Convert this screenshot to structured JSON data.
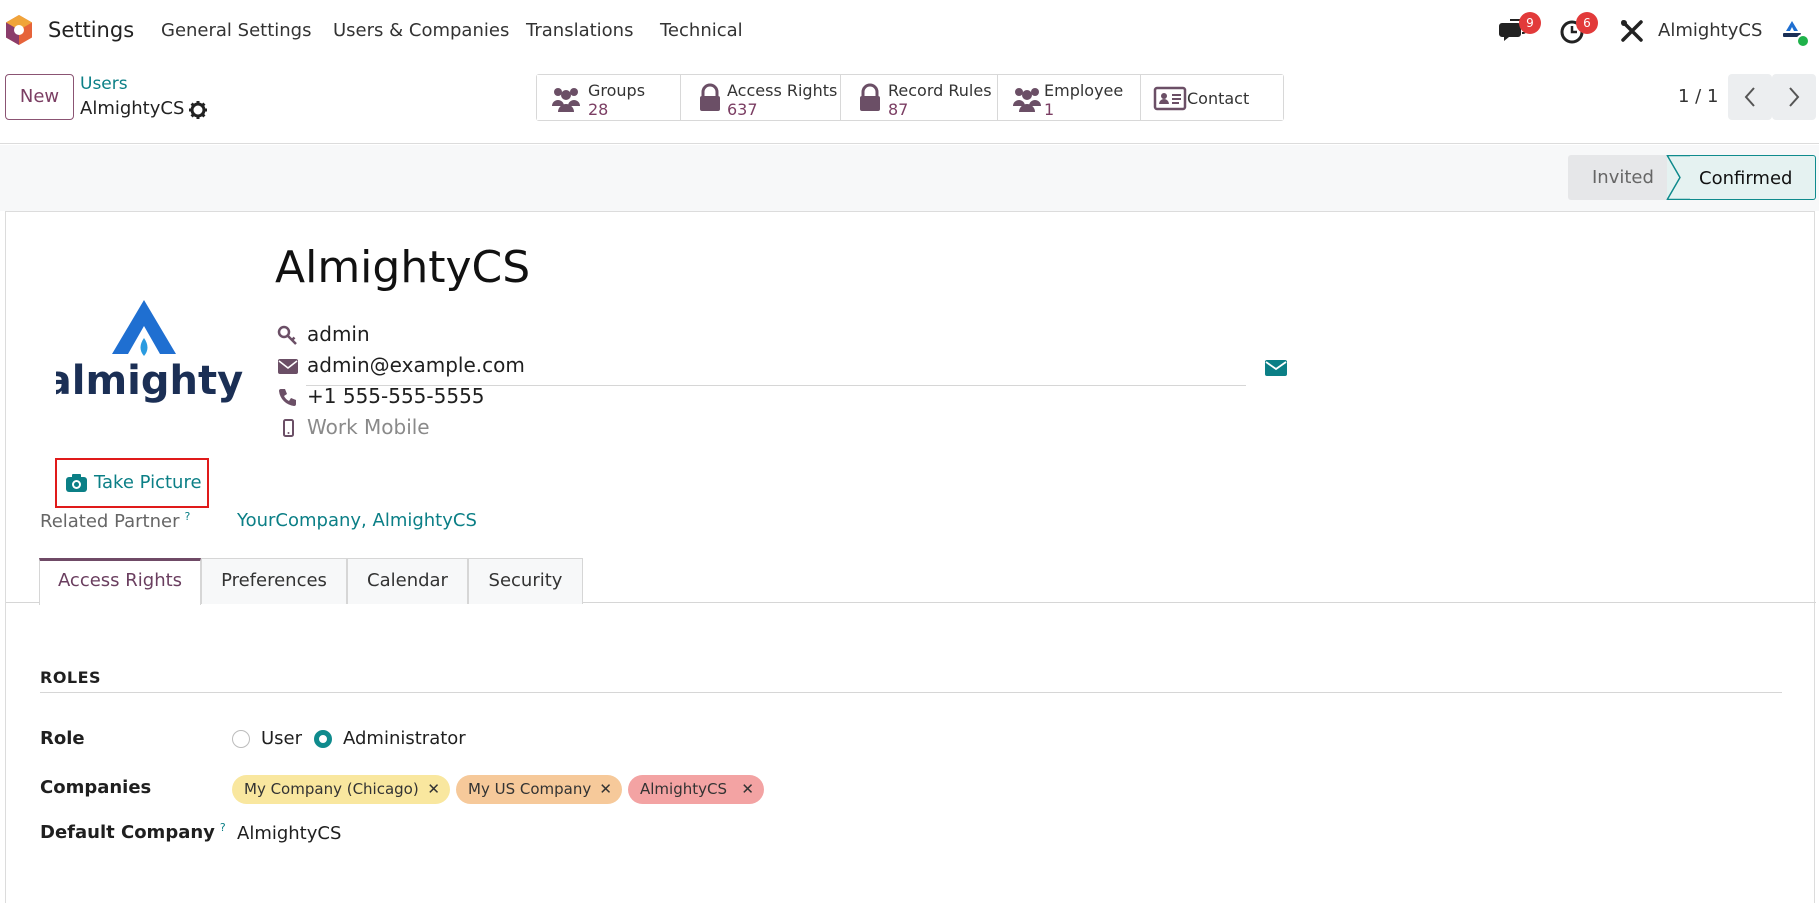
{
  "navbar": {
    "app_name": "Settings",
    "menu": [
      "General Settings",
      "Users & Companies",
      "Translations",
      "Technical"
    ],
    "messages_count": "9",
    "activities_count": "6",
    "user_name": "AlmightyCS",
    "icons": [
      "app-logo-icon",
      "chat-icon",
      "clock-icon",
      "tools-icon"
    ]
  },
  "control_panel": {
    "new_label": "New",
    "breadcrumb_parent": "Users",
    "breadcrumb_current": "AlmightyCS",
    "smart_buttons": [
      {
        "label": "Groups",
        "value": "28",
        "icon": "users-icon"
      },
      {
        "label": "Access Rights",
        "value": "637",
        "icon": "lock-icon"
      },
      {
        "label": "Record Rules",
        "value": "87",
        "icon": "lock-icon"
      },
      {
        "label": "Employee",
        "value": "1",
        "icon": "users-icon"
      },
      {
        "label": "Contact",
        "value": "",
        "icon": "id-card-icon"
      }
    ],
    "pager": "1 / 1"
  },
  "statusbar": {
    "invited": "Invited",
    "confirmed": "Confirmed",
    "active": "Confirmed"
  },
  "form": {
    "name": "AlmightyCS",
    "login": "admin",
    "email": "admin@example.com",
    "phone": "+1 555-555-5555",
    "mobile_placeholder": "Work Mobile",
    "take_picture_label": "Take Picture",
    "related_partner_label": "Related Partner",
    "related_partner_help": "?",
    "related_partner_value": "YourCompany, AlmightyCS",
    "logo_text": "almighty"
  },
  "tabs": [
    {
      "label": "Access Rights",
      "active": true
    },
    {
      "label": "Preferences",
      "active": false
    },
    {
      "label": "Calendar",
      "active": false
    },
    {
      "label": "Security",
      "active": false
    }
  ],
  "roles": {
    "section_title": "ROLES",
    "role_label": "Role",
    "options": [
      {
        "label": "User",
        "checked": false
      },
      {
        "label": "Administrator",
        "checked": true
      }
    ],
    "companies_label": "Companies",
    "companies": [
      {
        "name": "My Company (Chicago)",
        "color": "#f9e79f"
      },
      {
        "name": "My US Company",
        "color": "#f6c99a"
      },
      {
        "name": "AlmightyCS",
        "color": "#f3a3a3"
      }
    ],
    "default_company_label": "Default Company",
    "default_company_help": "?",
    "default_company_value": "AlmightyCS"
  },
  "colors": {
    "brand": "#7b3e63",
    "teal": "#0b7f86",
    "highlight_box": "#e01a1a"
  }
}
